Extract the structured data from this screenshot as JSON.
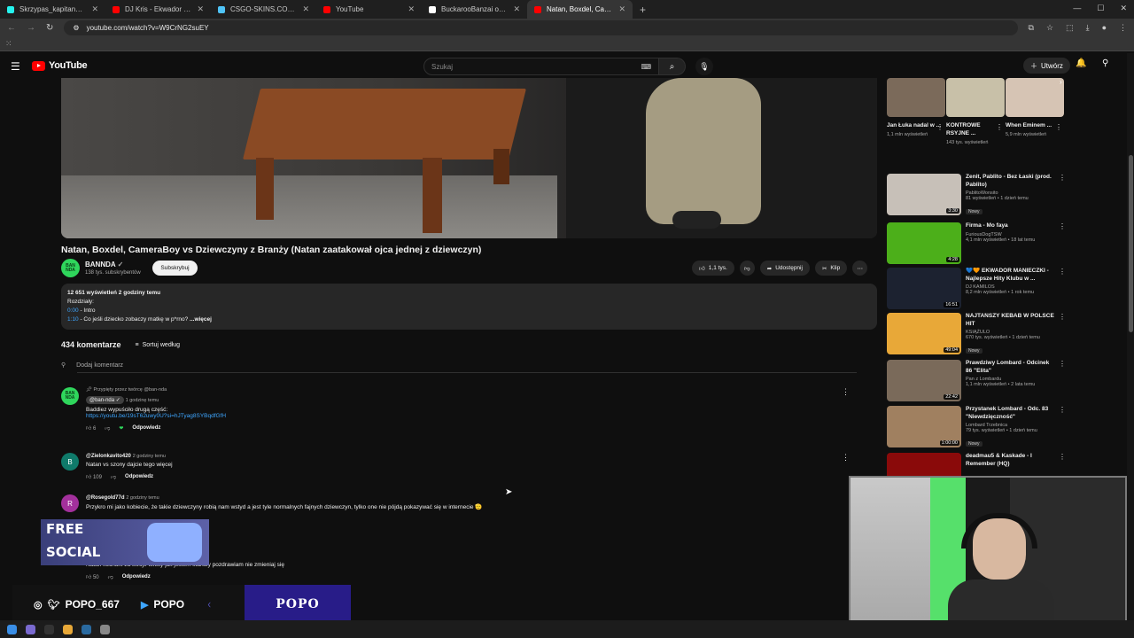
{
  "browser": {
    "tabs": [
      {
        "title": "Skrzypas_kapitan_polska (@skr...",
        "color": "#25f4ee"
      },
      {
        "title": "DJ Kris - Ekwador Manieczki | Mi...",
        "color": "#ff0000"
      },
      {
        "title": "CSGO-SKINS.COM - Najlepsze ...",
        "color": "#4fc3f7"
      },
      {
        "title": "YouTube",
        "color": "#ff0000"
      },
      {
        "title": "BuckarooBanzai on X: \"Samolot...",
        "color": "#ffffff"
      },
      {
        "title": "Natan, Boxdel, CameraBoy vs D...",
        "color": "#ff0000",
        "active": true
      }
    ],
    "url": "youtube.com/watch?v=W9CrNG2suEY"
  },
  "header": {
    "logo_text": "YouTube",
    "search_placeholder": "Szukaj",
    "create_label": "Utwórz"
  },
  "video": {
    "title": "Natan, Boxdel, CameraBoy vs Dziewczyny z Branży (Natan zaatakował ojca jednej z dziewczyn)",
    "channel": "BANNDA",
    "channel_avatar_text": "BAN NDA",
    "subscribers": "138 tys. subskrybentów",
    "subscribe_label": "Subskrybuj",
    "likes": "1,1 tys.",
    "share_label": "Udostępnij",
    "clip_label": "Klip"
  },
  "description": {
    "stats": "12 651 wyświetleń  2 godziny temu",
    "chapters_label": "Rozdziały:",
    "ch1_time": "0:00",
    "ch1_title": " - Intro",
    "ch2_time": "1:10",
    "ch2_title": " - Co jeśli dziecko zobaczy matkę w p*rno?",
    "more": " ...więcej"
  },
  "comments": {
    "count": "434 komentarze",
    "sort_label": "Sortuj według",
    "add_placeholder": "Dodaj komentarz",
    "reply_label": "Odpowiedz",
    "items": [
      {
        "pinned": "Przypięty przez twórcę @ban-nda",
        "author": "@ban-nda",
        "time": "1 godzinę temu",
        "text": "Baddiez wypuściło drugą część:",
        "link": "https://youtu.be/19sT62uwy0U?si=hJTyag8SYBqdfGfH",
        "likes": "6",
        "avatar_text": "BAN NDA",
        "avatar_color": "#2fd65c"
      },
      {
        "author": "@Zielonkavito420",
        "time": "2 godziny temu",
        "text": "Natan vs szony dajcie tego więcej",
        "likes": "109",
        "avatar_text": "B",
        "avatar_color": "#0f7a6a"
      },
      {
        "author": "@Rosegold77d",
        "time": "2 godziny temu",
        "text": "Przykro mi jako kobiecie, że takie dziewczyny robią nam wstyd a jest tyle normalnych fajnych dziewczyn, tylko one nie pójdą pokazywać się w internecie 🫡",
        "avatar_text": "R",
        "avatar_color": "#a3309c"
      },
      {
        "text": "Natan kochani za swoje teksty jak jestem starszy pozdrawiam nie zmieniaj się",
        "likes": "50"
      }
    ]
  },
  "shorts": [
    {
      "title": "Jan Łuka nadal w ...",
      "views": "1,1 mln wyświetleń",
      "color": "#7b6a5a"
    },
    {
      "title": "KONTROWE RSYJNE ...",
      "views": "143 tys. wyświetleń",
      "color": "#c8c0a8"
    },
    {
      "title": "When Eminem ...",
      "views": "5,9 mln wyświetleń",
      "color": "#d6c4b4"
    }
  ],
  "related": [
    {
      "title": "Zenit, Pablito - Bez Łaski (prod. Pablito)",
      "channel": "PablitoWonsito",
      "meta": "81 wyświetleń • 1 dzień temu",
      "badge": "Nowy",
      "duration": "3:30",
      "color": "#c7c0b8"
    },
    {
      "title": "Firma - Mo fayа",
      "channel": "FuriousDogTSW",
      "meta": "4,1 mln wyświetleń • 18 lat temu",
      "duration": "4:28",
      "color": "#4caf1a"
    },
    {
      "title": "💙🧡 EKWADOR MANIECZKI - Najlepsze Hity Klubu w ...",
      "channel": "DJ KAMILOS",
      "meta": "8,2 mln wyświetleń • 1 rok temu",
      "duration": "16:51",
      "color": "#1c2230"
    },
    {
      "title": "NAJTAŃSZY KEBAB W POLSCE HIT",
      "channel": "KSIĄŻULO",
      "meta": "670 tys. wyświetleń • 1 dzień temu",
      "badge": "Nowy",
      "duration": "49:04",
      "color": "#e8a838"
    },
    {
      "title": "Prawdziwy Lombard - Odcinek 86 \"Elita\"",
      "channel": "Pan z Lombardu",
      "meta": "1,1 mln wyświetleń • 2 lata temu",
      "duration": "22:42",
      "color": "#7a6a5a"
    },
    {
      "title": "Przystanek Lombard - Odc. 83 \"Niewdzięczność\"",
      "channel": "Lombard Trzebnica",
      "meta": "79 tys. wyświetleń • 1 dzień temu",
      "badge": "Nowy",
      "duration": "1:00:00",
      "color": "#a08060"
    },
    {
      "title": "deadmau5 & Kaskade - I Remember (HQ)",
      "channel": "",
      "meta": "",
      "duration": "",
      "color": "#8a0a0a"
    }
  ],
  "overlay": {
    "promo_line1": "FREE",
    "promo_line2": "SOCIAL",
    "instagram_handle": "POPO_667",
    "youtube_handle": "POPO",
    "brand": "POPO"
  }
}
